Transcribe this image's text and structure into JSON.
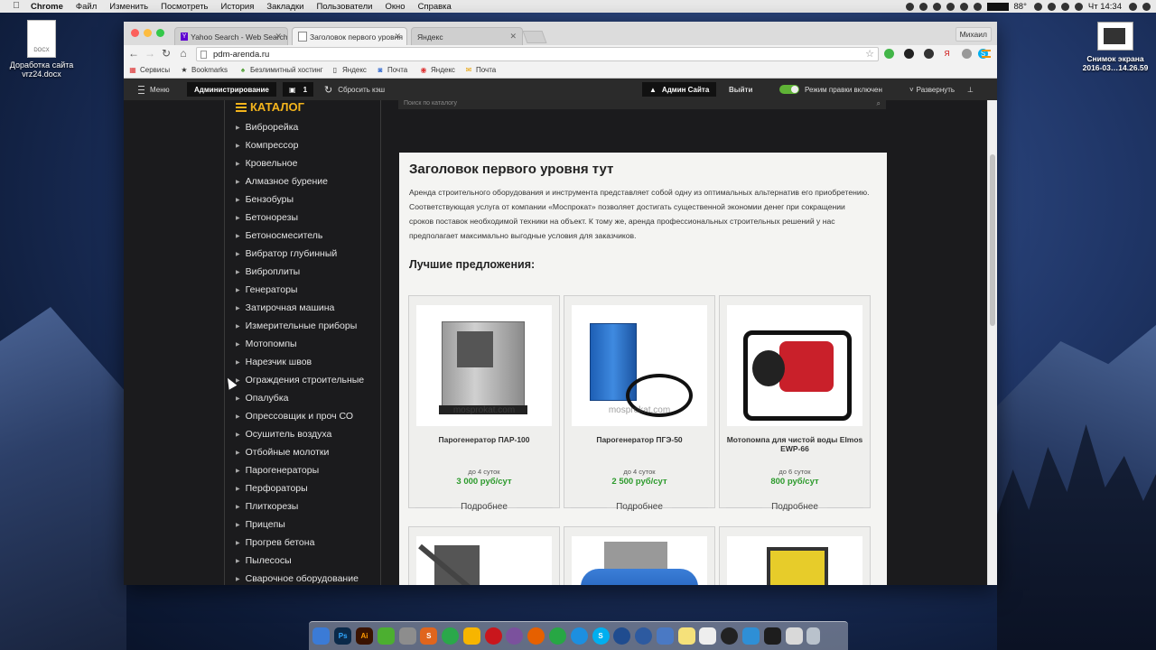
{
  "menubar": {
    "app": "Chrome",
    "items": [
      "Файл",
      "Изменить",
      "Посмотреть",
      "История",
      "Закладки",
      "Пользователи",
      "Окно",
      "Справка"
    ],
    "battery": "88°",
    "clock": "Чт 14:34"
  },
  "desktop": {
    "file_label": "Доработка сайта vrz24.docx",
    "file_badge": "DOCX",
    "screenshot_label": "Снимок экрана 2016-03…14.26.59"
  },
  "browser": {
    "tabs": [
      {
        "title": "Yahoo Search - Web Search",
        "icon": "Y"
      },
      {
        "title": "Заголовок первого уровня",
        "icon": ""
      },
      {
        "title": "Яндекс",
        "icon": ""
      }
    ],
    "profile": "Михаил",
    "url": "pdm-arenda.ru",
    "bookmarks": [
      {
        "label": "Сервисы",
        "icon": "grid-icon"
      },
      {
        "label": "Bookmarks",
        "icon": "star-icon"
      },
      {
        "label": "Безлимитный хостинг",
        "icon": "host-icon"
      },
      {
        "label": "Яндекс",
        "icon": "page-icon"
      },
      {
        "label": "Почта",
        "icon": "mail-icon"
      },
      {
        "label": "Яндекс",
        "icon": "yandex-icon"
      },
      {
        "label": "Почта",
        "icon": "mail-icon"
      }
    ]
  },
  "adminbar": {
    "menu": "Меню",
    "admin": "Администрирование",
    "badge": "1",
    "reset_cache": "Сбросить кэш",
    "admin_site": "Админ Сайта",
    "logout": "Выйти",
    "edit_mode": "Режим правки включен",
    "expand": "Развернуть"
  },
  "sidebar": {
    "title": "КАТАЛОГ",
    "items": [
      "Виброрейка",
      "Компрессор",
      "Кровельное",
      "Алмазное бурение",
      "Бензобуры",
      "Бетонорезы",
      "Бетоносмеситель",
      "Вибратор глубинный",
      "Виброплиты",
      "Генераторы",
      "Затирочная машина",
      "Измерительные приборы",
      "Мотопомпы",
      "Нарезчик швов",
      "Ограждения строительные",
      "Опалубка",
      "Опрессовщик и проч СО",
      "Осушитель воздуха",
      "Отбойные молотки",
      "Парогенераторы",
      "Перфораторы",
      "Плиткорезы",
      "Прицепы",
      "Прогрев бетона",
      "Пылесосы",
      "Сварочное оборудование"
    ]
  },
  "search": {
    "placeholder": "Поиск по каталогу"
  },
  "main": {
    "heading": "Заголовок первого уровня тут",
    "intro": "Аренда строительного оборудования и инструмента представляет собой одну из оптимальных альтернатив его приобретению. Соответствующая услуга от компании «Моспрокат» позволяет достигать существенной экономии денег при сокращении сроков поставок необходимой техники на объект. К тому же, аренда профессиональных строительных решений у нас предполагает максимально выгодные условия для заказчиков.",
    "offers_title": "Лучшие предложения:",
    "more_label": "Подробнее",
    "products": [
      {
        "name": "Парогенератор ПАР-100",
        "term": "до 4 суток",
        "price": "3 000 руб/сут",
        "watermark": "mosprokat.com"
      },
      {
        "name": "Парогенератор ПГЭ-50",
        "term": "до 4 суток",
        "price": "2 500 руб/сут",
        "watermark": "mosprokat.com"
      },
      {
        "name": "Мотопомпа для чистой воды Elmos EWP-66",
        "term": "до 6 суток",
        "price": "800 руб/сут",
        "watermark": ""
      }
    ]
  },
  "colors": {
    "accent": "#f3b41c",
    "price": "#2c9a2c",
    "admin_bg": "#2b2b2b",
    "toggle_on": "#5fb336"
  }
}
